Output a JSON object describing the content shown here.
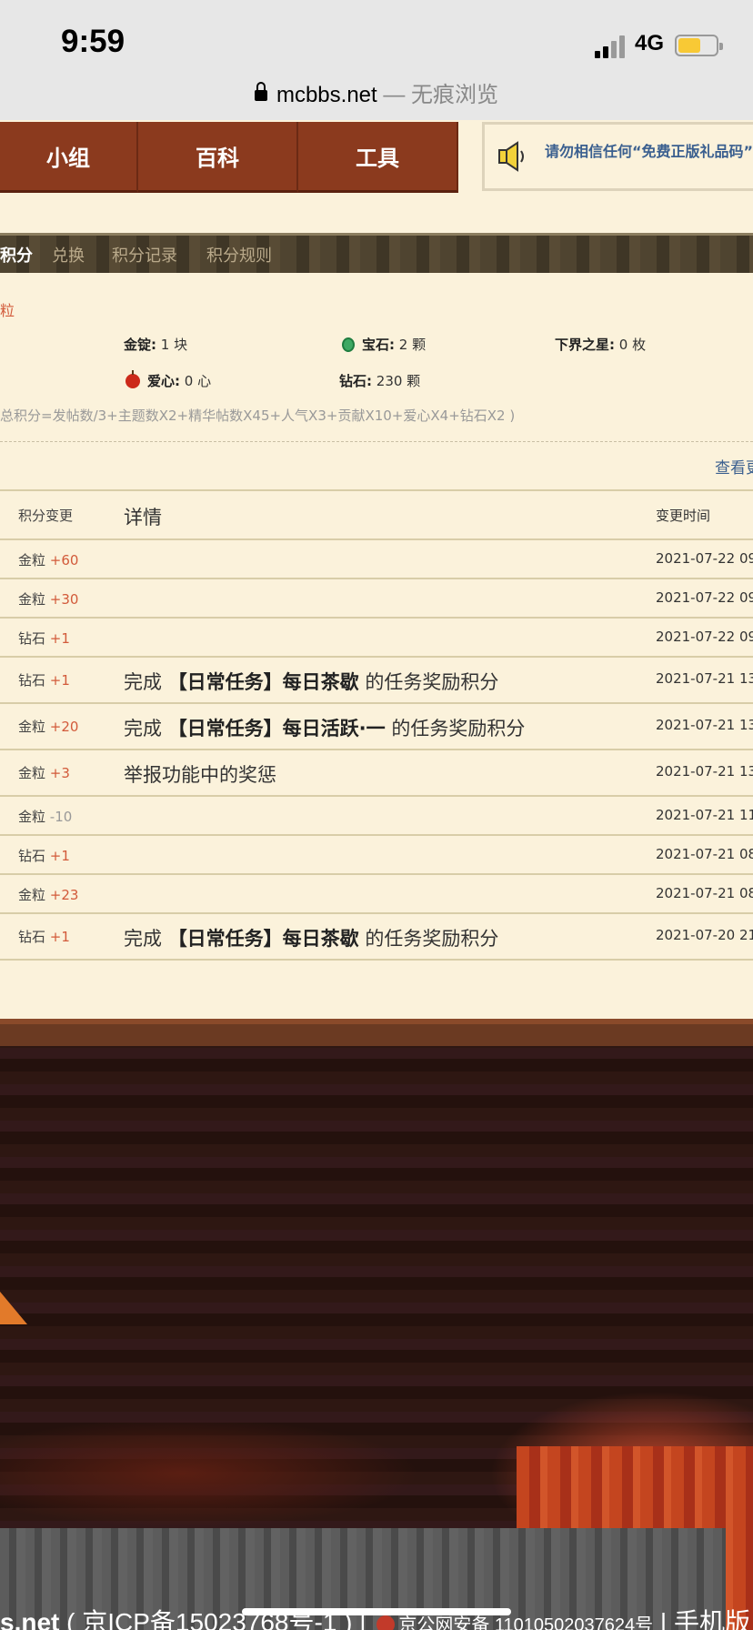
{
  "status_bar": {
    "time": "9:59",
    "network": "4G"
  },
  "url_bar": {
    "domain": "mcbbs.net",
    "mode": "— 无痕浏览"
  },
  "nav": {
    "items": [
      {
        "label": "小组"
      },
      {
        "label": "百科"
      },
      {
        "label": "工具"
      }
    ]
  },
  "notice": {
    "text": "请勿相信任何“免费正版礼品码”推"
  },
  "tabs": [
    {
      "label": "积分",
      "active": true
    },
    {
      "label": "兑换"
    },
    {
      "label": "积分记录"
    },
    {
      "label": "积分规则"
    }
  ],
  "summary": {
    "red_label": "粒",
    "stats": [
      {
        "label": "金锭:",
        "value": "1 块"
      },
      {
        "label": "宝石:",
        "value": "2 颗"
      },
      {
        "label": "下界之星:",
        "value": "0 枚"
      },
      {
        "label": "爱心:",
        "value": "0 心"
      },
      {
        "label": "钻石:",
        "value": "230 颗"
      }
    ],
    "formula": "总积分=发帖数/3+主题数X2+精华帖数X45+人气X3+贡献X10+爱心X4+钻石X2 )",
    "more_link": "查看更"
  },
  "table": {
    "headers": {
      "change": "积分变更",
      "detail": "详情",
      "time": "变更时间"
    },
    "rows": [
      {
        "item": "金粒",
        "delta": "+60",
        "detail_pre": "",
        "detail_bold": "",
        "detail_post": "",
        "time": "2021-07-22 09:"
      },
      {
        "item": "金粒",
        "delta": "+30",
        "detail_pre": "",
        "detail_bold": "",
        "detail_post": "",
        "time": "2021-07-22 09:"
      },
      {
        "item": "钻石",
        "delta": "+1",
        "detail_pre": "",
        "detail_bold": "",
        "detail_post": "",
        "time": "2021-07-22 09:"
      },
      {
        "item": "钻石",
        "delta": "+1",
        "detail_pre": "完成 ",
        "detail_bold": "【日常任务】每日茶歇",
        "detail_post": " 的任务奖励积分",
        "time": "2021-07-21 13:"
      },
      {
        "item": "金粒",
        "delta": "+20",
        "detail_pre": "完成 ",
        "detail_bold": "【日常任务】每日活跃·一",
        "detail_post": " 的任务奖励积分",
        "time": "2021-07-21 13:"
      },
      {
        "item": "金粒",
        "delta": "+3",
        "detail_pre": "举报功能中的奖惩",
        "detail_bold": "",
        "detail_post": "",
        "time": "2021-07-21 13:"
      },
      {
        "item": "金粒",
        "delta": "-10",
        "detail_pre": "",
        "detail_bold": "",
        "detail_post": "",
        "time": "2021-07-21 11:"
      },
      {
        "item": "钻石",
        "delta": "+1",
        "detail_pre": "",
        "detail_bold": "",
        "detail_post": "",
        "time": "2021-07-21 08:"
      },
      {
        "item": "金粒",
        "delta": "+23",
        "detail_pre": "",
        "detail_bold": "",
        "detail_post": "",
        "time": "2021-07-21 08:"
      },
      {
        "item": "钻石",
        "delta": "+1",
        "detail_pre": "完成 ",
        "detail_bold": "【日常任务】每日茶歇",
        "detail_post": " 的任务奖励积分",
        "time": "2021-07-20 21:"
      }
    ]
  },
  "footer": {
    "site": "s.net",
    "icp": " ( 京ICP备15023768号-1 ) | ",
    "police": "京公网安备 11010502037624号",
    "mobile": " | 手机版"
  }
}
